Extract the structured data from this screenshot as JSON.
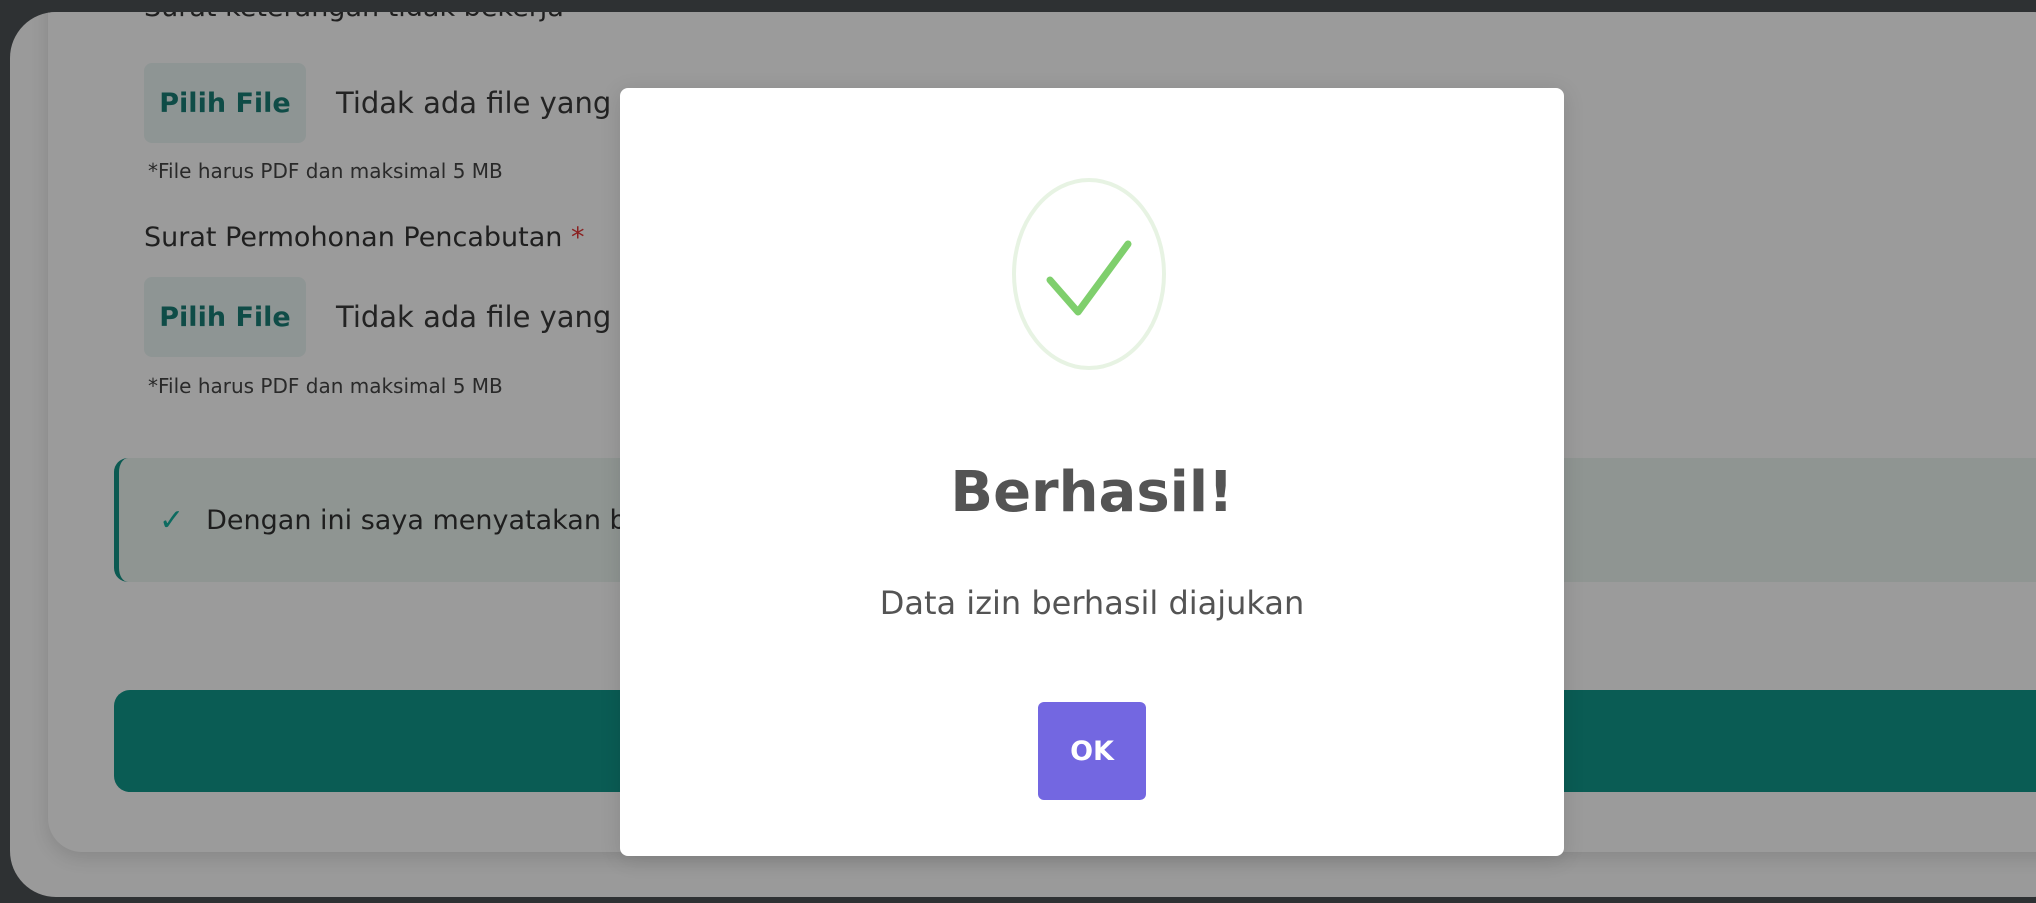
{
  "form": {
    "fields": [
      {
        "label": "Surat keterangan tidak bekerja",
        "button": "Pilih File",
        "file_status": "Tidak ada file yang dipilih",
        "hint": "*File harus PDF dan maksimal 5 MB"
      },
      {
        "label": "Surat Permohonan Pencabutan",
        "required": "*",
        "button": "Pilih File",
        "file_status": "Tidak ada file yang dipilih",
        "hint": "*File harus PDF dan maksimal 5 MB"
      }
    ],
    "consent_text": "Dengan ini saya menyatakan ba"
  },
  "modal": {
    "title": "Berhasil!",
    "message": "Data izin berhasil diajukan",
    "ok_label": "OK",
    "icon": "check-circle-icon",
    "accent_color": "#7367e1",
    "success_color": "#7fcf6d"
  }
}
